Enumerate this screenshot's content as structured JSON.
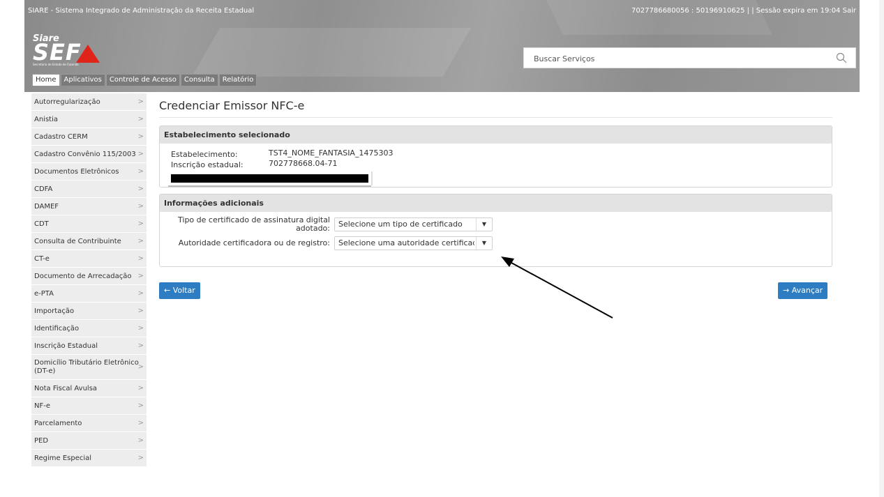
{
  "header": {
    "system_title": "SIARE - Sistema Integrado de Administração da Receita Estadual",
    "user_ids": "7027786680056 : 50196910625",
    "separator": "| |",
    "session": "Sessão expira em 19:04",
    "logout": "Sair",
    "logo_top": "Siare",
    "logo_main": "SEF",
    "logo_sub": "Secretaria de Estado de Fazenda",
    "search_placeholder": "Buscar Serviços"
  },
  "menu": [
    "Home",
    "Aplicativos",
    "Controle de Acesso",
    "Consulta",
    "Relatório"
  ],
  "sidebar": [
    "Autorregularização",
    "Anistia",
    "Cadastro CERM",
    "Cadastro Convênio 115/2003",
    "Documentos Eletrônicos",
    "CDFA",
    "DAMEF",
    "CDT",
    "Consulta de Contribuinte",
    "CT-e",
    "Documento de Arrecadação",
    "e-PTA",
    "Importação",
    "Identificação",
    "Inscrição Estadual",
    "Domicílio Tributário Eletrônico (DT-e)",
    "Nota Fiscal Avulsa",
    "NF-e",
    "Parcelamento",
    "PED",
    "Regime Especial"
  ],
  "page": {
    "title": "Credenciar Emissor NFC-e",
    "panel1_title": "Estabelecimento selecionado",
    "estab_label": "Estabelecimento:",
    "estab_value": "TST4_NOME_FANTASIA_1475303",
    "ie_label": "Inscrição estadual:",
    "ie_value": "702778668.04-71",
    "panel2_title": "Informações adicionais",
    "cert_label_1": "Tipo de certificado de assinatura digital",
    "cert_label_2": "adotado:",
    "cert_value": "Selecione um tipo de certificado",
    "auth_label": "Autoridade certificadora ou de registro:",
    "auth_value": "Selecione uma autoridade certificadora",
    "back_label": "← Voltar",
    "next_label": "→ Avançar"
  }
}
